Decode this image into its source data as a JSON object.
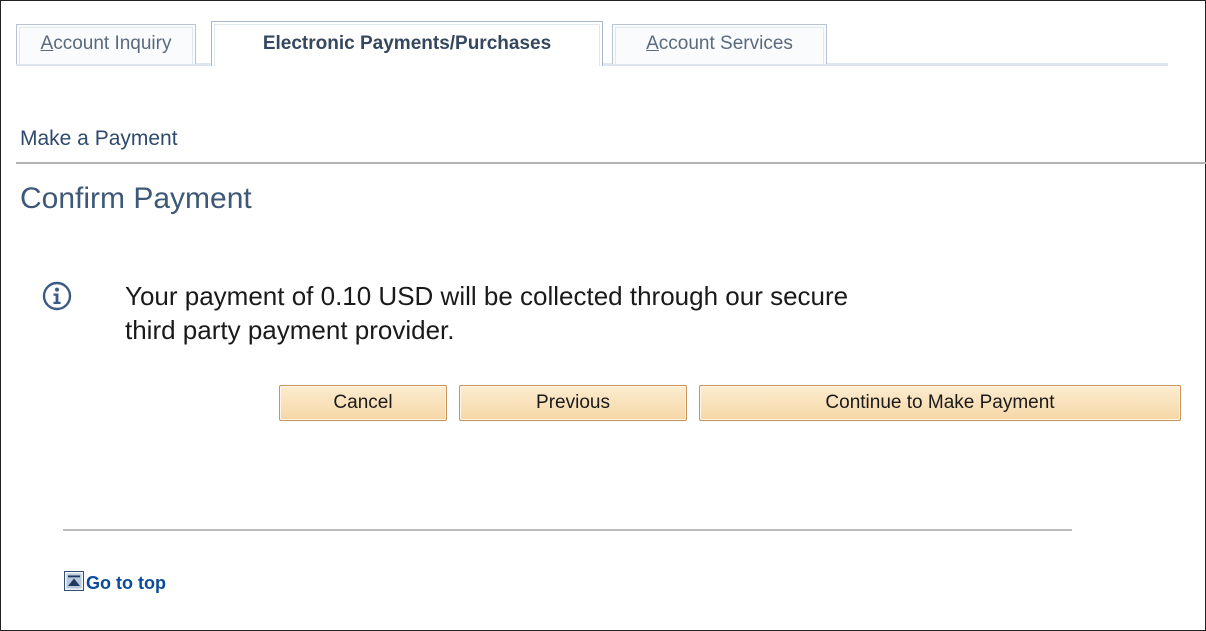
{
  "tabs": [
    {
      "label_first": "A",
      "label_rest": "ccount Inquiry",
      "active": false
    },
    {
      "label": "Electronic Payments/Purchases",
      "active": true
    },
    {
      "label_first": "A",
      "label_rest": "ccount Services",
      "active": false
    }
  ],
  "page": {
    "section_title": "Make a Payment",
    "title": "Confirm Payment"
  },
  "message": {
    "line1": "Your payment of 0.10 USD will be collected through our secure",
    "line2": "third party payment provider.",
    "icon": "info-icon"
  },
  "buttons": {
    "cancel": "Cancel",
    "previous": "Previous",
    "continue": "Continue to Make Payment"
  },
  "footer": {
    "go_to_top": "Go to top",
    "icon": "go-to-top-icon"
  },
  "colors": {
    "heading": "#3e5877",
    "link": "#0a4a98",
    "button_border": "#c8945c",
    "button_fill": "#f6d7a6"
  }
}
